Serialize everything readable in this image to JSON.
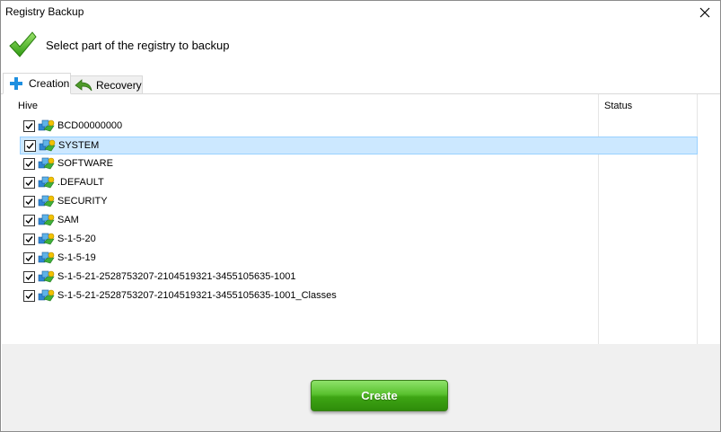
{
  "window": {
    "title": "Registry Backup",
    "close_icon": "close-icon"
  },
  "header": {
    "icon": "checkmark-icon",
    "text": "Select part of the registry to backup"
  },
  "tabs": [
    {
      "label": "Creation",
      "icon": "plus-icon",
      "active": true
    },
    {
      "label": "Recovery",
      "icon": "back-arrow-icon",
      "active": false
    }
  ],
  "list": {
    "columns": {
      "hive": "Hive",
      "status": "Status"
    },
    "rows": [
      {
        "label": "BCD00000000",
        "checked": true,
        "selected": false
      },
      {
        "label": "SYSTEM",
        "checked": true,
        "selected": true
      },
      {
        "label": "SOFTWARE",
        "checked": true,
        "selected": false
      },
      {
        "label": ".DEFAULT",
        "checked": true,
        "selected": false
      },
      {
        "label": "SECURITY",
        "checked": true,
        "selected": false
      },
      {
        "label": "SAM",
        "checked": true,
        "selected": false
      },
      {
        "label": "S-1-5-20",
        "checked": true,
        "selected": false
      },
      {
        "label": "S-1-5-19",
        "checked": true,
        "selected": false
      },
      {
        "label": "S-1-5-21-2528753207-2104519321-3455105635-1001",
        "checked": true,
        "selected": false
      },
      {
        "label": "S-1-5-21-2528753207-2104519321-3455105635-1001_Classes",
        "checked": true,
        "selected": false
      }
    ]
  },
  "footer": {
    "create_label": "Create",
    "accent_color": "#3ea514"
  }
}
